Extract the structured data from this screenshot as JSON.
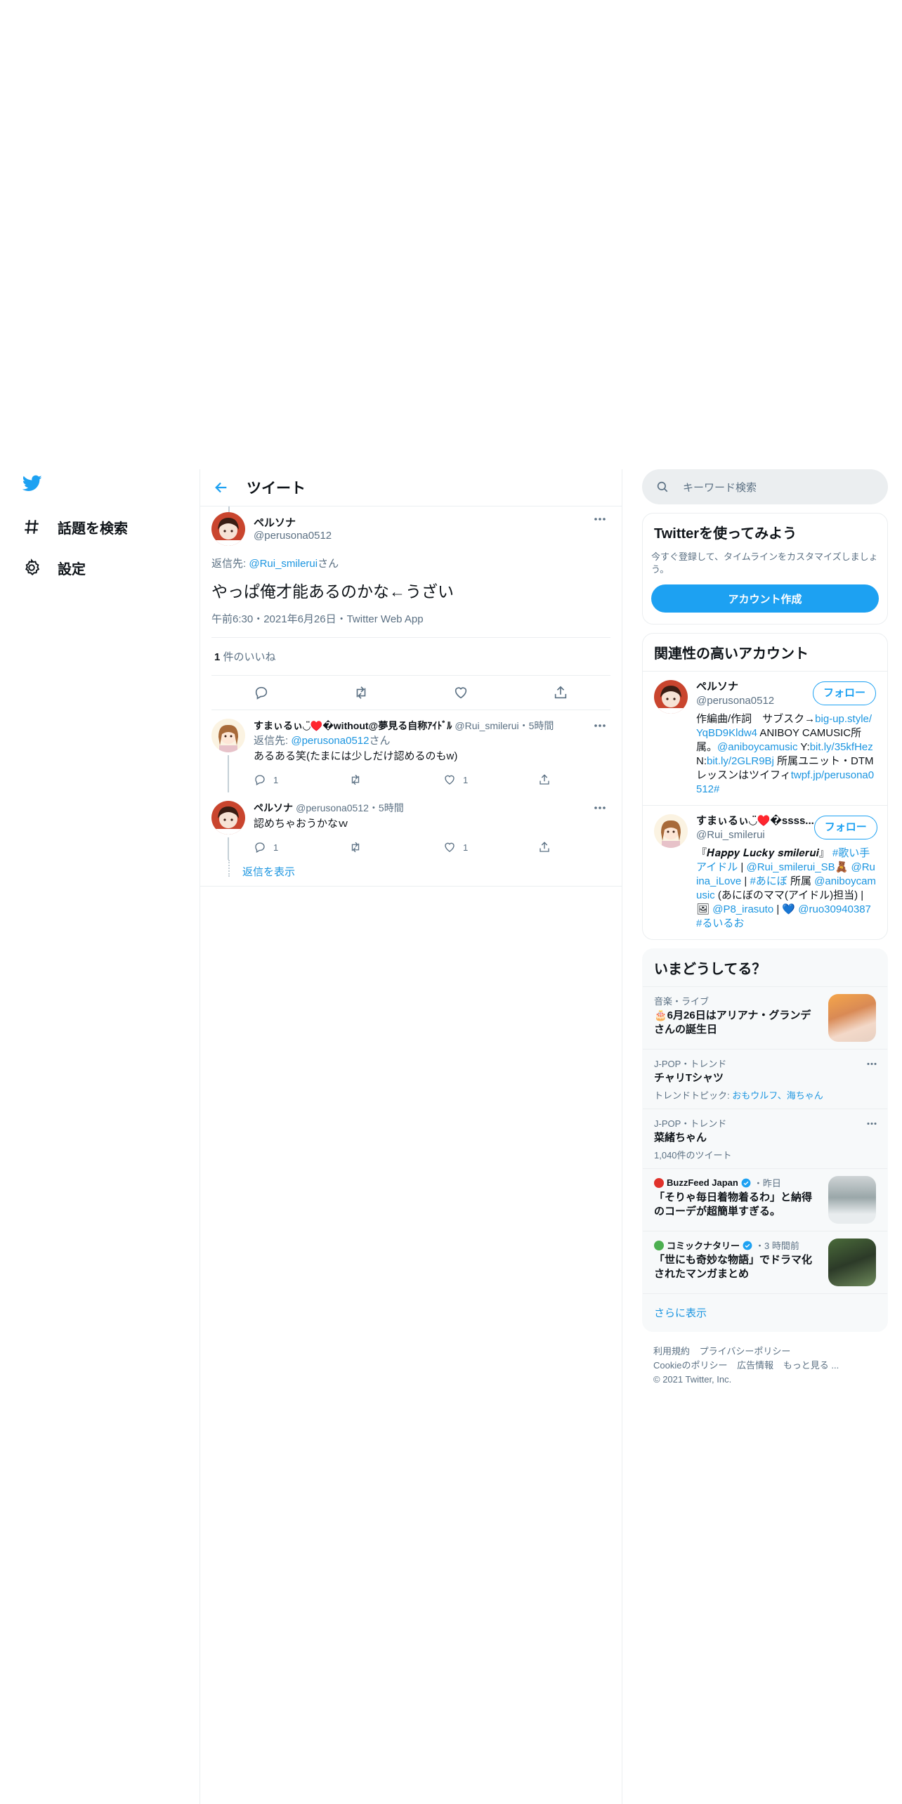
{
  "nav": {
    "explore_label": "話題を検索",
    "settings_label": "設定"
  },
  "header": {
    "title": "ツイート"
  },
  "focal_tweet": {
    "name": "ペルソナ",
    "handle": "@perusona0512",
    "reply_prefix": "返信先: ",
    "reply_handle": "@Rui_smilerui",
    "reply_suffix": "さん",
    "text": "やっぱ俺才能あるのかな←うざい",
    "meta": "午前6:30・2021年6月26日・Twitter Web App",
    "like_count": "1",
    "like_label": " 件のいいね"
  },
  "replies": [
    {
      "name": "すまぃるぃ◡̈♥️�without@夢見る自称ｱｲﾄﾞﾙ",
      "handle": "@Rui_smilerui",
      "time": "・5時間",
      "reply_prefix": "返信先: ",
      "reply_handle": "@perusona0512",
      "reply_suffix": "さん",
      "text": "あるある笑(たまには少しだけ認めるのもw)",
      "reply_count": "1",
      "retweet_count": "",
      "like_count": "1"
    },
    {
      "name": "ペルソナ",
      "handle": "@perusona0512",
      "time": "・5時間",
      "text": "認めちゃおうかなｗ",
      "reply_count": "1",
      "retweet_count": "",
      "like_count": "1"
    }
  ],
  "show_replies_label": "返信を表示",
  "search": {
    "placeholder": "キーワード検索"
  },
  "signup": {
    "title": "Twitterを使ってみよう",
    "subtitle": "今すぐ登録して、タイムラインをカスタマイズしましょう。",
    "button": "アカウント作成"
  },
  "relevant": {
    "title": "関連性の高いアカウント",
    "follow_label": "フォロー",
    "accounts": [
      {
        "name": "ペルソナ",
        "handle": "@perusona0512",
        "bio_1": "作編曲/作詞　サブスク→",
        "bio_link_1": "big-up.style/YqBD9Kldw4",
        "bio_2": " ANIBOY CAMUSIC所属。",
        "bio_link_2": "@aniboycamusic",
        "bio_3": " Y:",
        "bio_link_3": "bit.ly/35kfHez",
        "bio_4": " N:",
        "bio_link_4": "bit.ly/2GLR9Bj",
        "bio_5": " 所属ユニット・DTMレッスンはツイフィ",
        "bio_link_5": "twpf.jp/perusona0512#"
      },
      {
        "name": "すまぃるぃ◡̈♥️�ssss...",
        "handle": "@Rui_smilerui",
        "bio_1": "『𝑯𝒂𝒑𝒑𝒚 𝑳𝒖𝒄𝒌𝒚 𝒔𝒎𝒊𝒍𝒆𝒓𝒖𝒊』",
        "bio_link_1": "#歌い手アイドル",
        "bio_2": " | ",
        "bio_link_2": "@Rui_smilerui_SB",
        "bio_3": "🧸 ",
        "bio_link_3": "@Ruina_iLove",
        "bio_4": " | ",
        "bio_link_4": "#あにぼ",
        "bio_5": " 所属 ",
        "bio_link_5": "@aniboycamusic",
        "bio_6": " (あにぼのママ(アイドル)担当) | 🖼 ",
        "bio_link_6": "@P8_irasuto",
        "bio_7": " | 💙 ",
        "bio_link_7": "@ruo30940387",
        "bio_8": " ",
        "bio_link_8": "#るいるお"
      }
    ]
  },
  "trends": {
    "title": "いまどうしてる？",
    "items": [
      {
        "category": "音楽・ライブ",
        "title": "🎂6月26日はアリアナ・グランデさんの誕生日"
      },
      {
        "category": "J-POP・トレンド",
        "title": "チャリTシャツ",
        "extra_prefix": "トレンドトピック: ",
        "extra_link": "おもウルフ、海ちゃん"
      },
      {
        "category": "J-POP・トレンド",
        "title": "菜緒ちゃん",
        "extra": "1,040件のツイート"
      },
      {
        "source": "BuzzFeed Japan",
        "time": "・昨日",
        "title": "「そりゃ毎日着物着るわ」と納得のコーデが超簡単すぎる。"
      },
      {
        "source": "コミックナタリー",
        "time": "・3 時間前",
        "title": "「世にも奇妙な物語」でドラマ化されたマンガまとめ"
      }
    ],
    "show_more": "さらに表示"
  },
  "footer": {
    "links_1": [
      "利用規約",
      "プライバシーポリシー"
    ],
    "links_2": [
      "Cookieのポリシー",
      "広告情報",
      "もっと見る ..."
    ],
    "copyright": "© 2021 Twitter, Inc."
  },
  "colors": {
    "accent": "#1da1f2",
    "link": "#1b95e0",
    "secondary_text": "#5b7083",
    "border": "#ebeef0"
  },
  "icons": [
    "twitter-bird-icon",
    "hashtag-icon",
    "gear-icon",
    "back-arrow-icon",
    "more-icon",
    "reply-icon",
    "retweet-icon",
    "like-icon",
    "share-icon",
    "search-icon",
    "verified-icon"
  ]
}
